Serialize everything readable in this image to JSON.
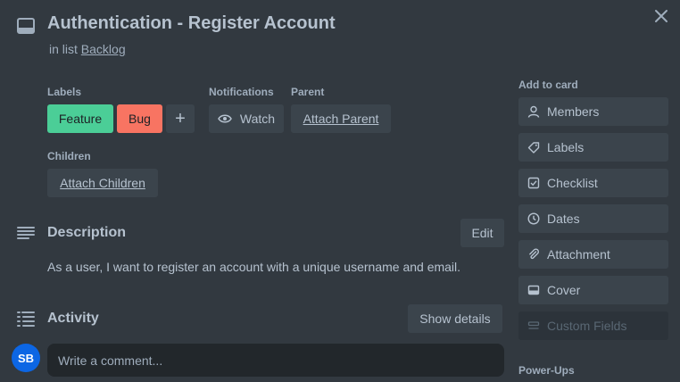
{
  "card": {
    "title": "Authentication - Register Account",
    "in_list_prefix": "in list",
    "list_name": "Backlog"
  },
  "labels_section": {
    "heading": "Labels",
    "items": [
      {
        "text": "Feature",
        "color": "#4bce97"
      },
      {
        "text": "Bug",
        "color": "#f87462"
      }
    ],
    "add_symbol": "+"
  },
  "notifications": {
    "heading": "Notifications",
    "watch_label": "Watch"
  },
  "parent": {
    "heading": "Parent",
    "button_label": "Attach Parent"
  },
  "children": {
    "heading": "Children",
    "button_label": "Attach Children"
  },
  "description": {
    "heading": "Description",
    "edit_label": "Edit",
    "text": "As a user, I want to register an account with a unique username and email."
  },
  "activity": {
    "heading": "Activity",
    "show_details_label": "Show details",
    "avatar_initials": "SB",
    "comment_placeholder": "Write a comment..."
  },
  "sidebar": {
    "add_to_card_heading": "Add to card",
    "items": [
      {
        "label": "Members",
        "icon": "person-icon",
        "enabled": true
      },
      {
        "label": "Labels",
        "icon": "tag-icon",
        "enabled": true
      },
      {
        "label": "Checklist",
        "icon": "checkbox-icon",
        "enabled": true
      },
      {
        "label": "Dates",
        "icon": "clock-icon",
        "enabled": true
      },
      {
        "label": "Attachment",
        "icon": "paperclip-icon",
        "enabled": true
      },
      {
        "label": "Cover",
        "icon": "cover-icon",
        "enabled": true
      },
      {
        "label": "Custom Fields",
        "icon": "custom-fields-icon",
        "enabled": false
      }
    ],
    "power_ups_heading": "Power-Ups"
  },
  "colors": {
    "background": "#323940",
    "button": "#3b444c",
    "avatar": "#0c66e4"
  }
}
